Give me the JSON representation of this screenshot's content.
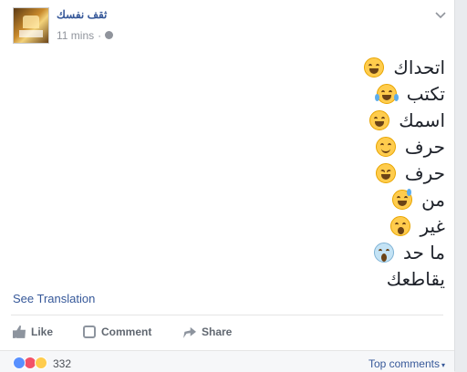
{
  "post": {
    "author": "ثقف نفسك",
    "timestamp": "11 mins",
    "separator": "·",
    "lines": [
      {
        "text": "اتحداك",
        "emoji": "grinning-face-icon"
      },
      {
        "text": "تكتب",
        "emoji": "tears-of-joy-icon"
      },
      {
        "text": "اسمك",
        "emoji": "grinning-face-icon"
      },
      {
        "text": "حرف",
        "emoji": "smiling-face-icon"
      },
      {
        "text": "حرف",
        "emoji": "squinting-face-icon"
      },
      {
        "text": "من",
        "emoji": "sweat-smile-icon"
      },
      {
        "text": "غير",
        "emoji": "astonished-face-icon"
      },
      {
        "text": "ما حد",
        "emoji": "screaming-face-icon"
      },
      {
        "text": "يقاطعك",
        "emoji": ""
      }
    ],
    "see_translation": "See Translation"
  },
  "actions": {
    "like": "Like",
    "comment": "Comment",
    "share": "Share"
  },
  "reactions": {
    "icons": [
      "like-reaction-icon",
      "love-reaction-icon",
      "haha-reaction-icon"
    ],
    "count": "332",
    "top_comments": "Top comments",
    "caret": "▾"
  },
  "colors": {
    "link": "#365899",
    "muted": "#90949c",
    "text": "#1d2129",
    "like": "#5890ff",
    "love": "#f25268"
  }
}
